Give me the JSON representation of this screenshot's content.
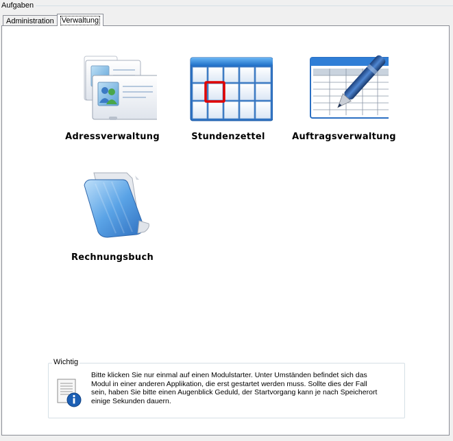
{
  "group": {
    "title": "Aufgaben"
  },
  "tabs": [
    {
      "label": "Administration",
      "active": false
    },
    {
      "label": "Verwaltung",
      "active": true
    }
  ],
  "modules": [
    {
      "label": "Adressverwaltung",
      "icon": "address-cards-icon"
    },
    {
      "label": "Stundenzettel",
      "icon": "calendar-grid-icon"
    },
    {
      "label": "Auftragsverwaltung",
      "icon": "spreadsheet-pen-icon"
    },
    {
      "label": "Rechnungsbuch",
      "icon": "blue-folder-icon"
    }
  ],
  "info": {
    "legend": "Wichtig",
    "icon": "document-info-icon",
    "lines": [
      "Bitte klicken Sie nur einmal auf einen Modulstarter.  Unter Umständen befindet sich das",
      "Modul in einer anderen Applikation, die erst gestartet werden muss. Sollte dies der Fall",
      "sein, haben Sie bitte einen Augenblick Geduld, der Startvorgang kann je nach Speicherort",
      "einige Sekunden dauern."
    ]
  },
  "colors": {
    "panel_border": "#898c95",
    "calendar_header": "#2b7fd6",
    "calendar_highlight": "#e00000",
    "folder_blue": "#4a90d9"
  }
}
